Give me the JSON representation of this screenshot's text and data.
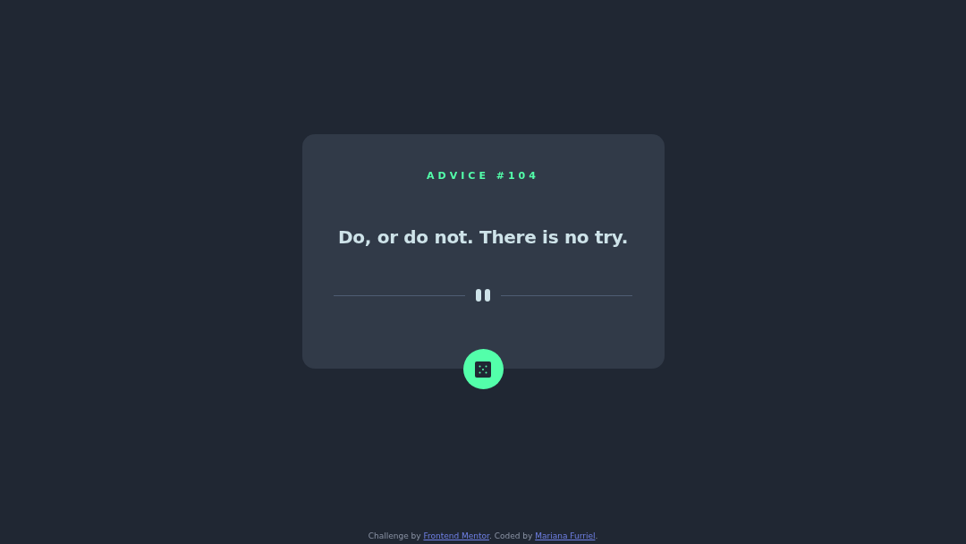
{
  "card": {
    "heading": "ADVICE #104",
    "quote": "Do, or do not. There is no try."
  },
  "footer": {
    "parts": [
      {
        "kind": "text",
        "text": "Challenge by "
      },
      {
        "kind": "link",
        "text": "Frontend Mentor"
      },
      {
        "kind": "text",
        "text": ". Coded by "
      },
      {
        "kind": "link",
        "text": "Mariana Furriel"
      },
      {
        "kind": "text",
        "text": "."
      }
    ]
  }
}
